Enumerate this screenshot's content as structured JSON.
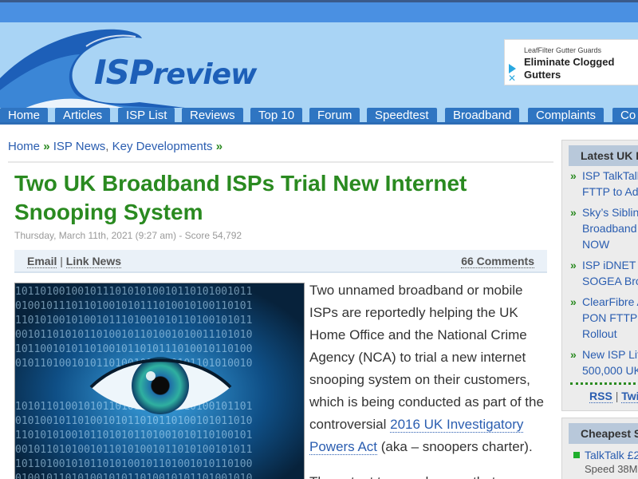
{
  "header": {
    "logo_isp": "ISP",
    "logo_review": "review",
    "ad": {
      "kicker": "LeafFilter Gutter Guards",
      "headline": "Eliminate Clogged Gutters",
      "play_icon": "play-icon",
      "close_icon": "close-icon"
    }
  },
  "nav": {
    "items": [
      {
        "label": "Home"
      },
      {
        "label": "Articles"
      },
      {
        "label": "ISP List"
      },
      {
        "label": "Reviews"
      },
      {
        "label": "Top 10"
      },
      {
        "label": "Forum"
      },
      {
        "label": "Speedtest"
      },
      {
        "label": "Broadband"
      },
      {
        "label": "Complaints"
      },
      {
        "label": "Co"
      }
    ]
  },
  "breadcrumb": {
    "home": "Home",
    "sep": "»",
    "isp_news": "ISP News",
    "comma": ",",
    "key_developments": "Key Developments"
  },
  "article": {
    "title": "Two UK Broadband ISPs Trial New Internet Snooping System",
    "meta": "Thursday, March 11th, 2021 (9:27 am) - Score 54,792",
    "email": "Email",
    "divider": "|",
    "link_news": "Link News",
    "comments": "66 Comments",
    "para1_before": "Two unnamed broadband or mobile ISPs are reportedly helping the UK Home Office and the National Crime Agency (NCA) to trial a new internet snooping system on their customers, which is being conducted as part of the controversial ",
    "para1_link": "2016 UK Investigatory Powers Act",
    "para1_after": " (aka – snoopers charter).",
    "para2_start": "The extent to… and aware that"
  },
  "sidebar": {
    "latest": {
      "heading": "Latest UK I",
      "bullet": "»",
      "items": [
        {
          "line1": "ISP TalkTalk",
          "line2": "FTTP to Ad"
        },
        {
          "line1": "Sky’s Siblin",
          "line2": "Broadband",
          "line3": "NOW"
        },
        {
          "line1": "ISP iDNET",
          "line2": "SOGEA Bro"
        },
        {
          "line1": "ClearFibre A",
          "line2": "PON FTTP",
          "line3": "Rollout"
        },
        {
          "line1": "New ISP Lit",
          "line2": "500,000 UK"
        }
      ],
      "rss": "RSS",
      "divider": "|",
      "twitter": "Twi"
    },
    "cheapest": {
      "heading": "Cheapest S",
      "item": "TalkTalk £2",
      "sub": "Speed 38M"
    }
  },
  "colors": {
    "title_green": "#2a8a20",
    "link_blue": "#2a5db0",
    "nav_blue": "#2f75c2",
    "header_sky": "#a9d4f5"
  }
}
